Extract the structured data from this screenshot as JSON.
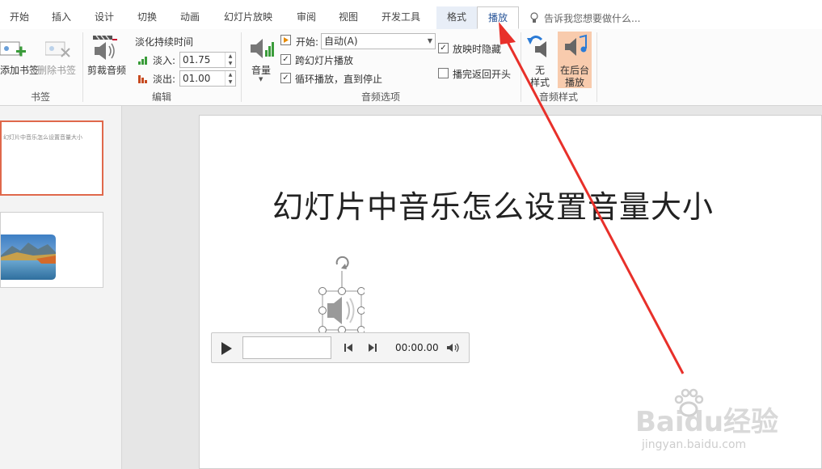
{
  "tabs": [
    "开始",
    "插入",
    "设计",
    "切换",
    "动画",
    "幻灯片放映",
    "审阅",
    "视图",
    "开发工具",
    "格式",
    "播放"
  ],
  "tell_me": "告诉我您想要做什么...",
  "ribbon": {
    "bookmarks": {
      "add": "添加书签",
      "remove": "删除书签",
      "group": "书签"
    },
    "editing": {
      "trim": "剪裁音频",
      "fade_title": "淡化持续时间",
      "fade_in_label": "淡入:",
      "fade_in_value": "01.75",
      "fade_out_label": "淡出:",
      "fade_out_value": "01.00",
      "group": "编辑"
    },
    "audio_options": {
      "volume": "音量",
      "start_label": "开始:",
      "start_value": "自动(A)",
      "play_across": "跨幻灯片播放",
      "loop": "循环播放，直到停止",
      "hide": "放映时隐藏",
      "rewind": "播完返回开头",
      "group": "音频选项",
      "play_across_checked": true,
      "loop_checked": true,
      "hide_checked": true,
      "rewind_checked": false
    },
    "audio_styles": {
      "no_style_1": "无",
      "no_style_2": "样式",
      "bg_1": "在后台",
      "bg_2": "播放",
      "group": "音频样式"
    }
  },
  "thumbnails": {
    "slide1_title": "幻灯片中音乐怎么设置音量大小"
  },
  "slide": {
    "title": "幻灯片中音乐怎么设置音量大小"
  },
  "player": {
    "time": "00:00.00"
  },
  "watermark": {
    "logo": "Baidu经验",
    "url": "jingyan.baidu.com"
  },
  "colors": {
    "accent": "#2b579a",
    "thumb_selected": "#e0684b",
    "arrow": "#e8302a",
    "bg_highlight": "#f8cbad"
  }
}
